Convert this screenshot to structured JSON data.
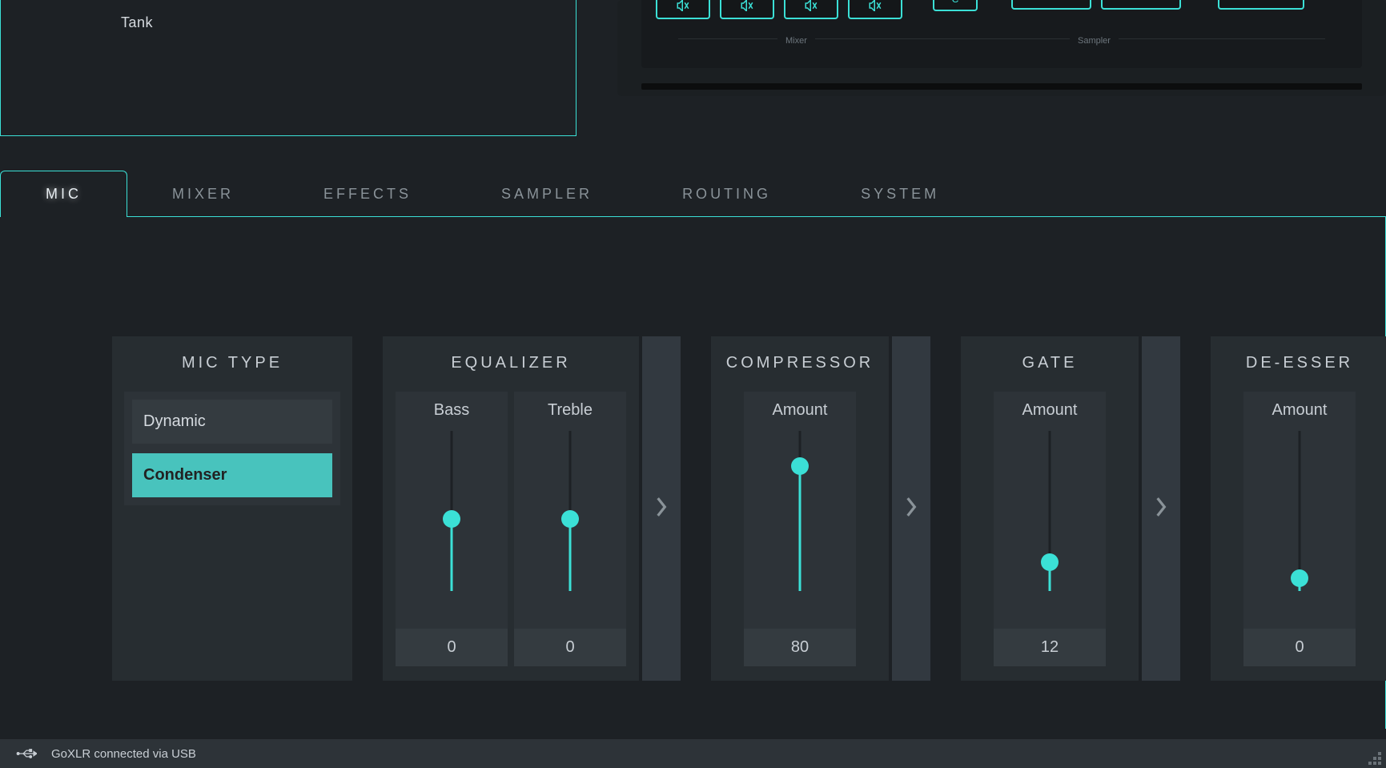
{
  "profile": {
    "item": "Tank"
  },
  "hardware": {
    "mixer_label": "Mixer",
    "sampler_label": "Sampler",
    "c_button_label": "C"
  },
  "tabs": [
    {
      "label": "MIC",
      "active": true
    },
    {
      "label": "MIXER",
      "active": false
    },
    {
      "label": "EFFECTS",
      "active": false
    },
    {
      "label": "SAMPLER",
      "active": false
    },
    {
      "label": "ROUTING",
      "active": false
    },
    {
      "label": "SYSTEM",
      "active": false
    }
  ],
  "mic_type": {
    "title": "MIC TYPE",
    "options": [
      "Dynamic",
      "Condenser"
    ],
    "selected": "Condenser"
  },
  "equalizer": {
    "title": "EQUALIZER",
    "sliders": [
      {
        "label": "Bass",
        "value": 0,
        "percent": 45
      },
      {
        "label": "Treble",
        "value": 0,
        "percent": 45
      }
    ]
  },
  "compressor": {
    "title": "COMPRESSOR",
    "slider": {
      "label": "Amount",
      "value": 80,
      "percent": 78
    }
  },
  "gate": {
    "title": "GATE",
    "slider": {
      "label": "Amount",
      "value": 12,
      "percent": 18
    }
  },
  "deesser": {
    "title": "DE-ESSER",
    "slider": {
      "label": "Amount",
      "value": 0,
      "percent": 8
    }
  },
  "status": {
    "text": "GoXLR connected via USB"
  }
}
